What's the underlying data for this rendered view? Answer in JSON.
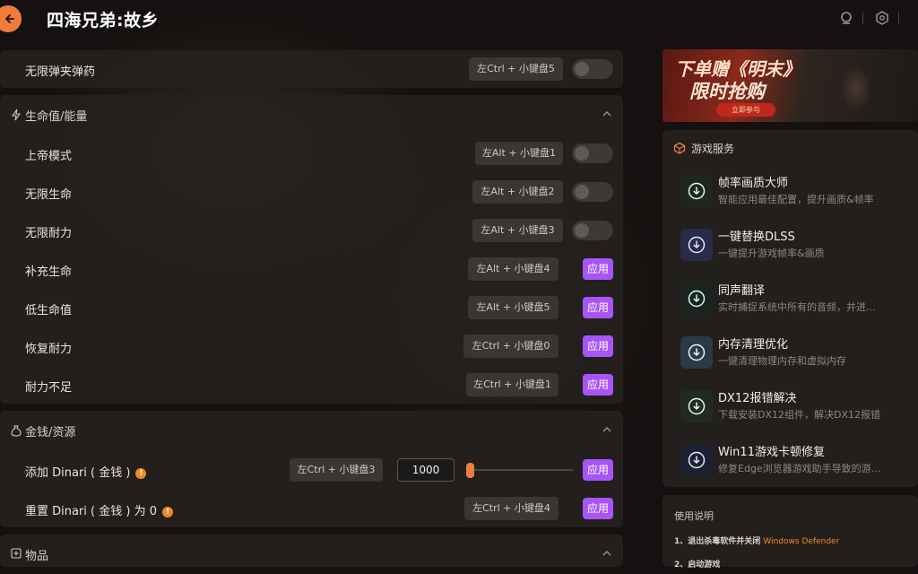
{
  "app": {
    "title": "四海兄弟:故乡"
  },
  "colors": {
    "accent_orange": "#f07c3a",
    "apply_purple": "#a855f7",
    "background": "#141110"
  },
  "top_row": {
    "label": "无限弹夹弹药",
    "hotkey": "左Ctrl + 小键盘5",
    "toggle_on": false
  },
  "sections": {
    "health": {
      "title": "生命值/能量",
      "rows": [
        {
          "label": "上帝模式",
          "hotkey": "左Alt + 小键盘1",
          "control": "toggle"
        },
        {
          "label": "无限生命",
          "hotkey": "左Alt + 小键盘2",
          "control": "toggle"
        },
        {
          "label": "无限耐力",
          "hotkey": "左Alt + 小键盘3",
          "control": "toggle"
        },
        {
          "label": "补充生命",
          "hotkey": "左Alt + 小键盘4",
          "control": "apply",
          "apply": "应用"
        },
        {
          "label": "低生命值",
          "hotkey": "左Alt + 小键盘5",
          "control": "apply",
          "apply": "应用"
        },
        {
          "label": "恢复耐力",
          "hotkey": "左Ctrl + 小键盘0",
          "control": "apply",
          "apply": "应用"
        },
        {
          "label": "耐力不足",
          "hotkey": "左Ctrl + 小键盘1",
          "control": "apply",
          "apply": "应用"
        }
      ]
    },
    "money": {
      "title": "金钱/资源",
      "rows": [
        {
          "label": "添加 Dinari ( 金钱 )",
          "info": "!",
          "hotkey": "左Ctrl + 小键盘3",
          "value": "1000",
          "slider_fraction": 0.0,
          "apply": "应用"
        },
        {
          "label": "重置 Dinari ( 金钱 ) 为 0",
          "info": "!",
          "hotkey": "左Ctrl + 小键盘4",
          "apply": "应用"
        }
      ]
    },
    "items": {
      "title": "物品"
    }
  },
  "banner": {
    "title": "下单赠《明末》",
    "subtitle": "限时抢购",
    "button": "立即参与"
  },
  "services": {
    "title": "游戏服务",
    "items": [
      {
        "title": "帧率画质大师",
        "desc": "智能应用最佳配置，提升画质&帧率"
      },
      {
        "title": "一键替换DLSS",
        "desc": "一键提升游戏帧率&画质"
      },
      {
        "title": "同声翻译",
        "desc": "实时捕捉系统中所有的音频，并进..."
      },
      {
        "title": "内存清理优化",
        "desc": "一键清理物理内存和虚拟内存"
      },
      {
        "title": "DX12报错解决",
        "desc": "下载安装DX12组件，解决DX12报错"
      },
      {
        "title": "Win11游戏卡顿修复",
        "desc": "修复Edge浏览器游戏助手导致的游..."
      }
    ]
  },
  "help": {
    "title": "使用说明",
    "step1_prefix": "1、退出杀毒软件并关闭",
    "step1_highlight": "Windows Defender",
    "step2": "2、启动游戏"
  }
}
